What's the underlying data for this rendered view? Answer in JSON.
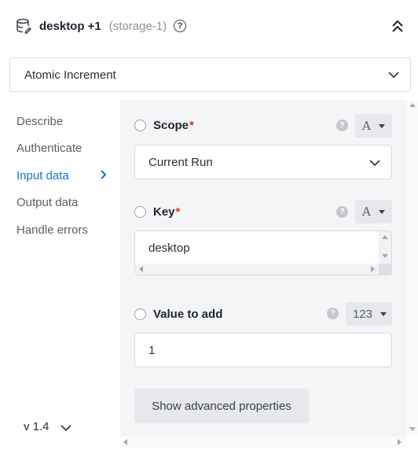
{
  "header": {
    "title": "desktop +1",
    "subtitle": "(storage-1)",
    "icons": {
      "storage": "database-icon",
      "help": "help-circle-icon",
      "collapse": "double-chevron-up-icon"
    }
  },
  "action_select": {
    "value": "Atomic Increment",
    "icon": "chevron-down-icon"
  },
  "sidebar": {
    "items": [
      {
        "label": "Describe",
        "active": false
      },
      {
        "label": "Authenticate",
        "active": false
      },
      {
        "label": "Input data",
        "active": true
      },
      {
        "label": "Output data",
        "active": false
      },
      {
        "label": "Handle errors",
        "active": false
      }
    ],
    "version": "v 1.4"
  },
  "fields": {
    "scope": {
      "label": "Scope",
      "required": "*",
      "type_label": "A",
      "value": "Current Run"
    },
    "key": {
      "label": "Key",
      "required": "*",
      "type_label": "A",
      "value": "desktop"
    },
    "value_to_add": {
      "label": "Value to add",
      "type_label": "123",
      "value": "1"
    }
  },
  "help_glyph": "?",
  "advanced_button": "Show advanced properties",
  "colors": {
    "accent": "#1a6fd6",
    "required": "#d93025",
    "panel_bg": "#f4f5f7"
  }
}
